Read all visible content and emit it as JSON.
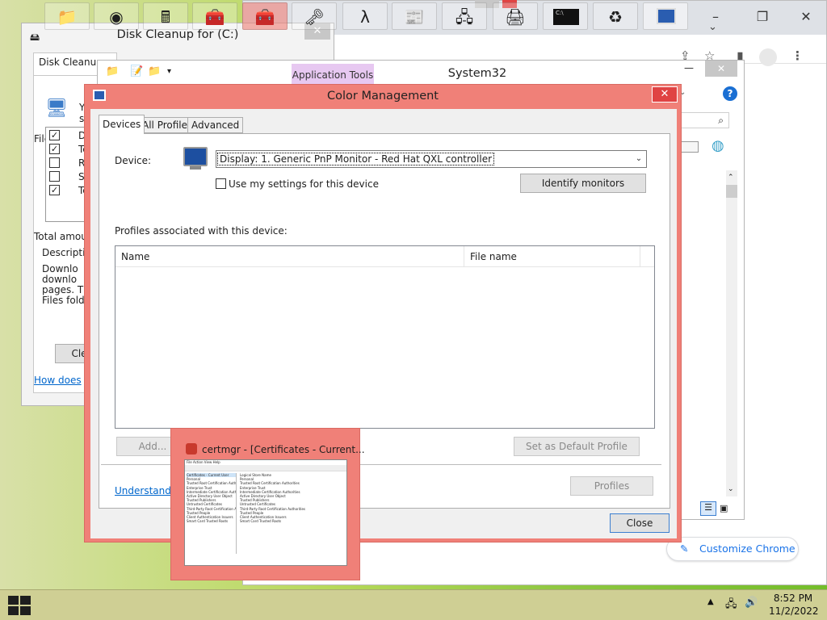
{
  "disk_cleanup": {
    "title": "Disk Cleanup for  (C:)",
    "tab": "Disk Cleanup",
    "intro": "You c",
    "intro2": "sp",
    "files_label": "Files to del",
    "items": [
      "De",
      "Te",
      "Re",
      "Se",
      "Te"
    ],
    "total_label": "Total amou",
    "desc_label": "Descripti",
    "desc_lines": [
      "Downlo",
      "downlo",
      "pages. T",
      "Files fold"
    ],
    "cleanup_button": "Cle",
    "help_link": "How does"
  },
  "system32": {
    "title": "System32",
    "ribbon_tab": "Application Tools"
  },
  "color_management": {
    "title": "Color Management",
    "tabs": [
      "Devices",
      "All Profiles",
      "Advanced"
    ],
    "device_label": "Device:",
    "device_value": "Display: 1. Generic PnP Monitor - Red Hat QXL controller",
    "use_settings_label": "Use my settings for this device",
    "identify_button": "Identify monitors",
    "profiles_label": "Profiles associated with this device:",
    "columns": [
      "Name",
      "File name"
    ],
    "add_button": "Add...",
    "set_default_button": "Set as Default Profile",
    "profiles_button": "Profiles",
    "understanding_link": "Understandin",
    "close_button": "Close"
  },
  "thumbnail": {
    "title": "certmgr - [Certificates - Current...",
    "preview_root": "Certificates - Current User",
    "preview_items": [
      "Personal",
      "Trusted Root Certification Authorities",
      "Enterprise Trust",
      "Intermediate Certification Authorities",
      "Active Directory User Object",
      "Trusted Publishers",
      "Untrusted Certificates",
      "Third-Party Root Certification Authorities",
      "Trusted People",
      "Client Authentication Issuers",
      "Smart Card Trusted Roots"
    ],
    "preview_menu": [
      "File",
      "Action",
      "View",
      "Help"
    ],
    "preview_header": "Logical Store Name"
  },
  "chrome": {
    "customize_button": "Customize Chrome"
  },
  "taskbar": {
    "time": "8:52 PM",
    "date": "11/2/2022"
  }
}
